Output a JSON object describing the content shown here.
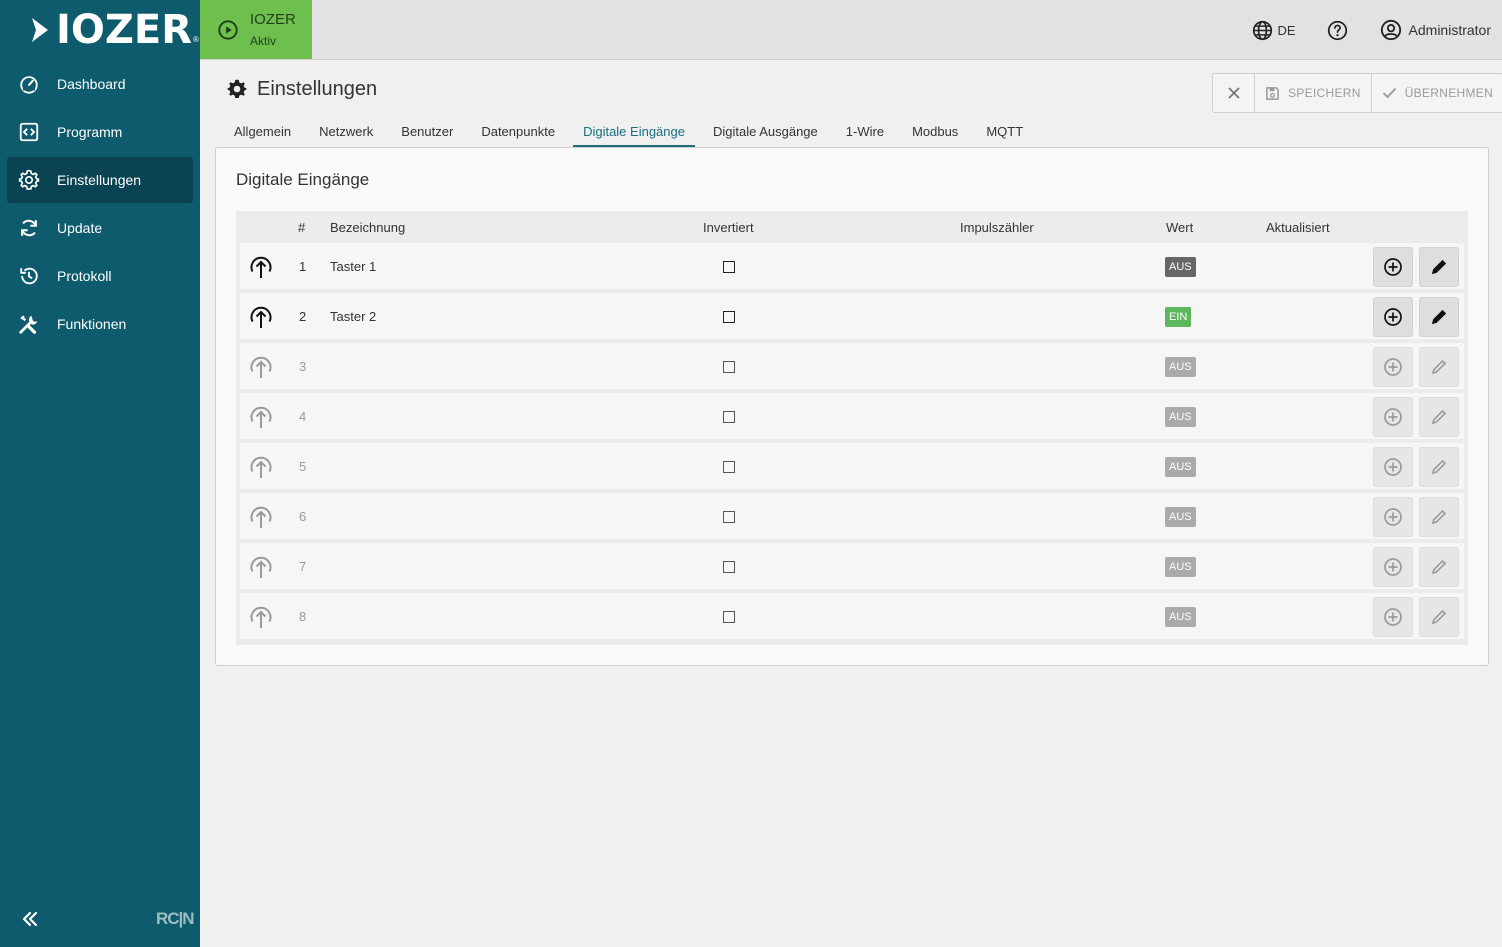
{
  "app": {
    "brand": "IOZER",
    "brand_reg": "®"
  },
  "sidebar": {
    "items": [
      {
        "label": "Dashboard",
        "icon": "speedometer-icon"
      },
      {
        "label": "Programm",
        "icon": "code-box-icon"
      },
      {
        "label": "Einstellungen",
        "icon": "gear-icon",
        "active": true
      },
      {
        "label": "Update",
        "icon": "refresh-icon"
      },
      {
        "label": "Protokoll",
        "icon": "history-icon"
      },
      {
        "label": "Funktionen",
        "icon": "tools-icon"
      }
    ],
    "collapse_icon": "double-chevron-left-icon",
    "footer_logo": "RC|N"
  },
  "topbar": {
    "status_title": "IOZER",
    "status_sub": "Aktiv",
    "language": "DE",
    "user": "Administrator"
  },
  "header": {
    "title": "Einstellungen",
    "cancel_icon": "close-icon",
    "save_label": "SPEICHERN",
    "apply_label": "ÜBERNEHMEN"
  },
  "tabs": [
    {
      "label": "Allgemein"
    },
    {
      "label": "Netzwerk"
    },
    {
      "label": "Benutzer"
    },
    {
      "label": "Datenpunkte"
    },
    {
      "label": "Digitale Eingänge",
      "active": true
    },
    {
      "label": "Digitale Ausgänge"
    },
    {
      "label": "1-Wire"
    },
    {
      "label": "Modbus"
    },
    {
      "label": "MQTT"
    }
  ],
  "card": {
    "title": "Digitale Eingänge",
    "columns": {
      "num": "#",
      "name": "Bezeichnung",
      "inverted": "Invertiert",
      "counter": "Impulszähler",
      "value": "Wert",
      "updated": "Aktualisiert"
    },
    "rows": [
      {
        "num": "1",
        "name": "Taster 1",
        "inverted": false,
        "value": "AUS",
        "configured": true
      },
      {
        "num": "2",
        "name": "Taster 2",
        "inverted": false,
        "value": "EIN",
        "configured": true
      },
      {
        "num": "3",
        "name": "",
        "inverted": false,
        "value": "AUS",
        "configured": false
      },
      {
        "num": "4",
        "name": "",
        "inverted": false,
        "value": "AUS",
        "configured": false
      },
      {
        "num": "5",
        "name": "",
        "inverted": false,
        "value": "AUS",
        "configured": false
      },
      {
        "num": "6",
        "name": "",
        "inverted": false,
        "value": "AUS",
        "configured": false
      },
      {
        "num": "7",
        "name": "",
        "inverted": false,
        "value": "AUS",
        "configured": false
      },
      {
        "num": "8",
        "name": "",
        "inverted": false,
        "value": "AUS",
        "configured": false
      }
    ]
  },
  "colors": {
    "sidebar": "#0d5b6c",
    "sidebar_active": "#0a4453",
    "status_green": "#6fbf4e",
    "badge_on": "#5cb85c",
    "badge_off": "#666666",
    "badge_off_dim": "#aaaaaa",
    "accent": "#1a6e80"
  }
}
